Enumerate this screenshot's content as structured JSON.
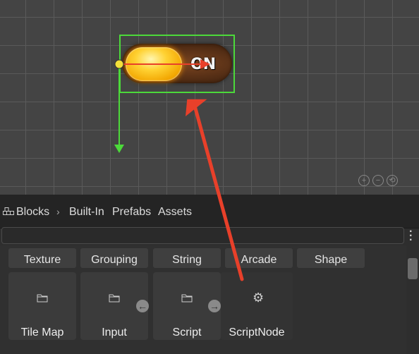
{
  "scene": {
    "toggle_label": "ON",
    "zoom_icons": [
      "zoom-in-icon",
      "zoom-out-icon",
      "zoom-reset-icon"
    ]
  },
  "panel": {
    "tabs": [
      {
        "label": "Blocks",
        "icon": "blocks-icon"
      },
      {
        "label": "Built-In"
      },
      {
        "label": "Prefabs"
      },
      {
        "label": "Assets"
      }
    ],
    "search_value": "",
    "menu_icon": "more-vert-icon",
    "categories": [
      "Texture",
      "Grouping",
      "String",
      "Arcade",
      "Shape"
    ],
    "tiles": [
      {
        "label": "Tile Map",
        "icon": "folder-icon"
      },
      {
        "label": "Input",
        "icon": "folder-icon"
      },
      {
        "label": "Script",
        "icon": "folder-icon"
      },
      {
        "label": "ScriptNode",
        "icon": "gear-icon"
      }
    ]
  },
  "colors": {
    "selection": "#4cd93a",
    "annotation_arrow": "#e8402a",
    "panel_bg": "#2e2e2e"
  }
}
